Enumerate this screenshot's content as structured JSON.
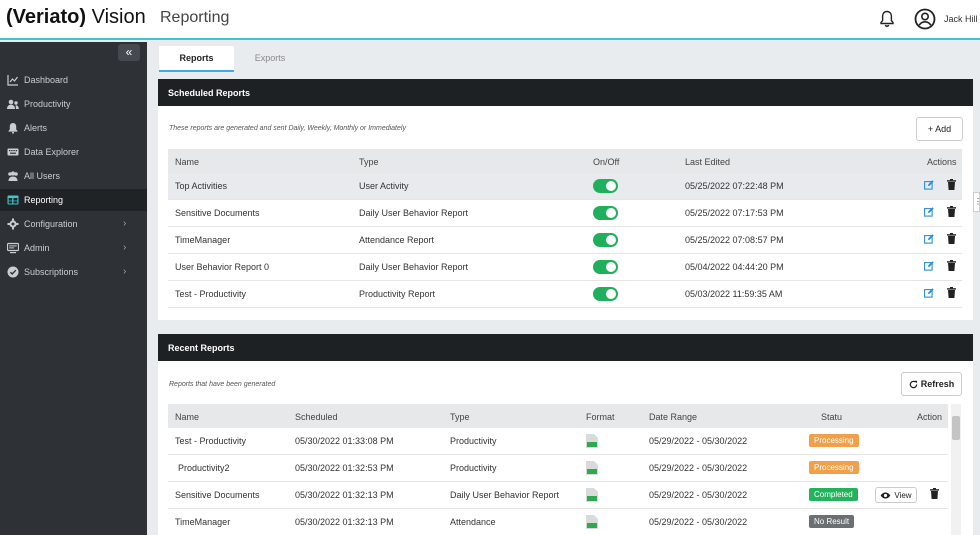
{
  "app": {
    "logo_brand": "(Veriato)",
    "logo_product": "Vision",
    "page_title": "Reporting",
    "user_name": "Jack Hill"
  },
  "sidebar": {
    "collapse_glyph": "«",
    "items": [
      {
        "label": "Dashboard",
        "icon": "chart-line-icon"
      },
      {
        "label": "Productivity",
        "icon": "users-icon"
      },
      {
        "label": "Alerts",
        "icon": "bell-icon"
      },
      {
        "label": "Data Explorer",
        "icon": "keyboard-icon"
      },
      {
        "label": "All Users",
        "icon": "users-icon"
      },
      {
        "label": "Reporting",
        "icon": "table-icon",
        "active": true
      },
      {
        "label": "Configuration",
        "icon": "gear-icon",
        "has_children": true
      },
      {
        "label": "Admin",
        "icon": "monitor-icon",
        "has_children": true
      },
      {
        "label": "Subscriptions",
        "icon": "check-circle-icon",
        "has_children": true
      }
    ]
  },
  "tabs": [
    {
      "label": "Reports",
      "active": true
    },
    {
      "label": "Exports",
      "active": false
    }
  ],
  "scheduled": {
    "title": "Scheduled Reports",
    "subtitle": "These reports are generated and sent Daily, Weekly, Monthly or Immediately",
    "add_label": "+ Add",
    "columns": [
      "Name",
      "Type",
      "On/Off",
      "Last Edited",
      "Actions"
    ],
    "rows": [
      {
        "name": "Top Activities",
        "type": "User Activity",
        "on": true,
        "edited": "05/25/2022 07:22:48 PM"
      },
      {
        "name": "Sensitive Documents",
        "type": "Daily User Behavior Report",
        "on": true,
        "edited": "05/25/2022 07:17:53 PM"
      },
      {
        "name": "TimeManager",
        "type": "Attendance Report",
        "on": true,
        "edited": "05/25/2022 07:08:57 PM"
      },
      {
        "name": "User Behavior Report 0",
        "type": "Daily User Behavior Report",
        "on": true,
        "edited": "05/04/2022 04:44:20 PM"
      },
      {
        "name": "Test - Productivity",
        "type": "Productivity Report",
        "on": true,
        "edited": "05/03/2022 11:59:35 AM"
      }
    ]
  },
  "recent": {
    "title": "Recent Reports",
    "subtitle": "Reports that have been generated",
    "refresh_label": "Refresh",
    "columns": [
      "Name",
      "Scheduled",
      "Type",
      "Format",
      "Date Range",
      "Statu",
      "Action"
    ],
    "view_label": "View",
    "rows": [
      {
        "name": "Test - Productivity",
        "scheduled": "05/30/2022 01:33:08 PM",
        "type": "Productivity",
        "range": "05/29/2022 - 05/30/2022",
        "status": "Processing"
      },
      {
        "name": "Productivity2",
        "scheduled": "05/30/2022 01:32:53 PM",
        "type": "Productivity",
        "range": "05/29/2022 - 05/30/2022",
        "status": "Processing"
      },
      {
        "name": "Sensitive Documents",
        "scheduled": "05/30/2022 01:32:13 PM",
        "type": "Daily User Behavior Report",
        "range": "05/29/2022 - 05/30/2022",
        "status": "Completed"
      },
      {
        "name": "TimeManager",
        "scheduled": "05/30/2022 01:32:13 PM",
        "type": "Attendance",
        "range": "05/29/2022 - 05/30/2022",
        "status": "No Result"
      }
    ]
  },
  "colors": {
    "accent": "#3fc6cc",
    "processing": "#f0a04b",
    "completed": "#22b35c",
    "no_result": "#6c6f72",
    "toggle_on": "#20b05c",
    "edit": "#2d8fd6"
  }
}
